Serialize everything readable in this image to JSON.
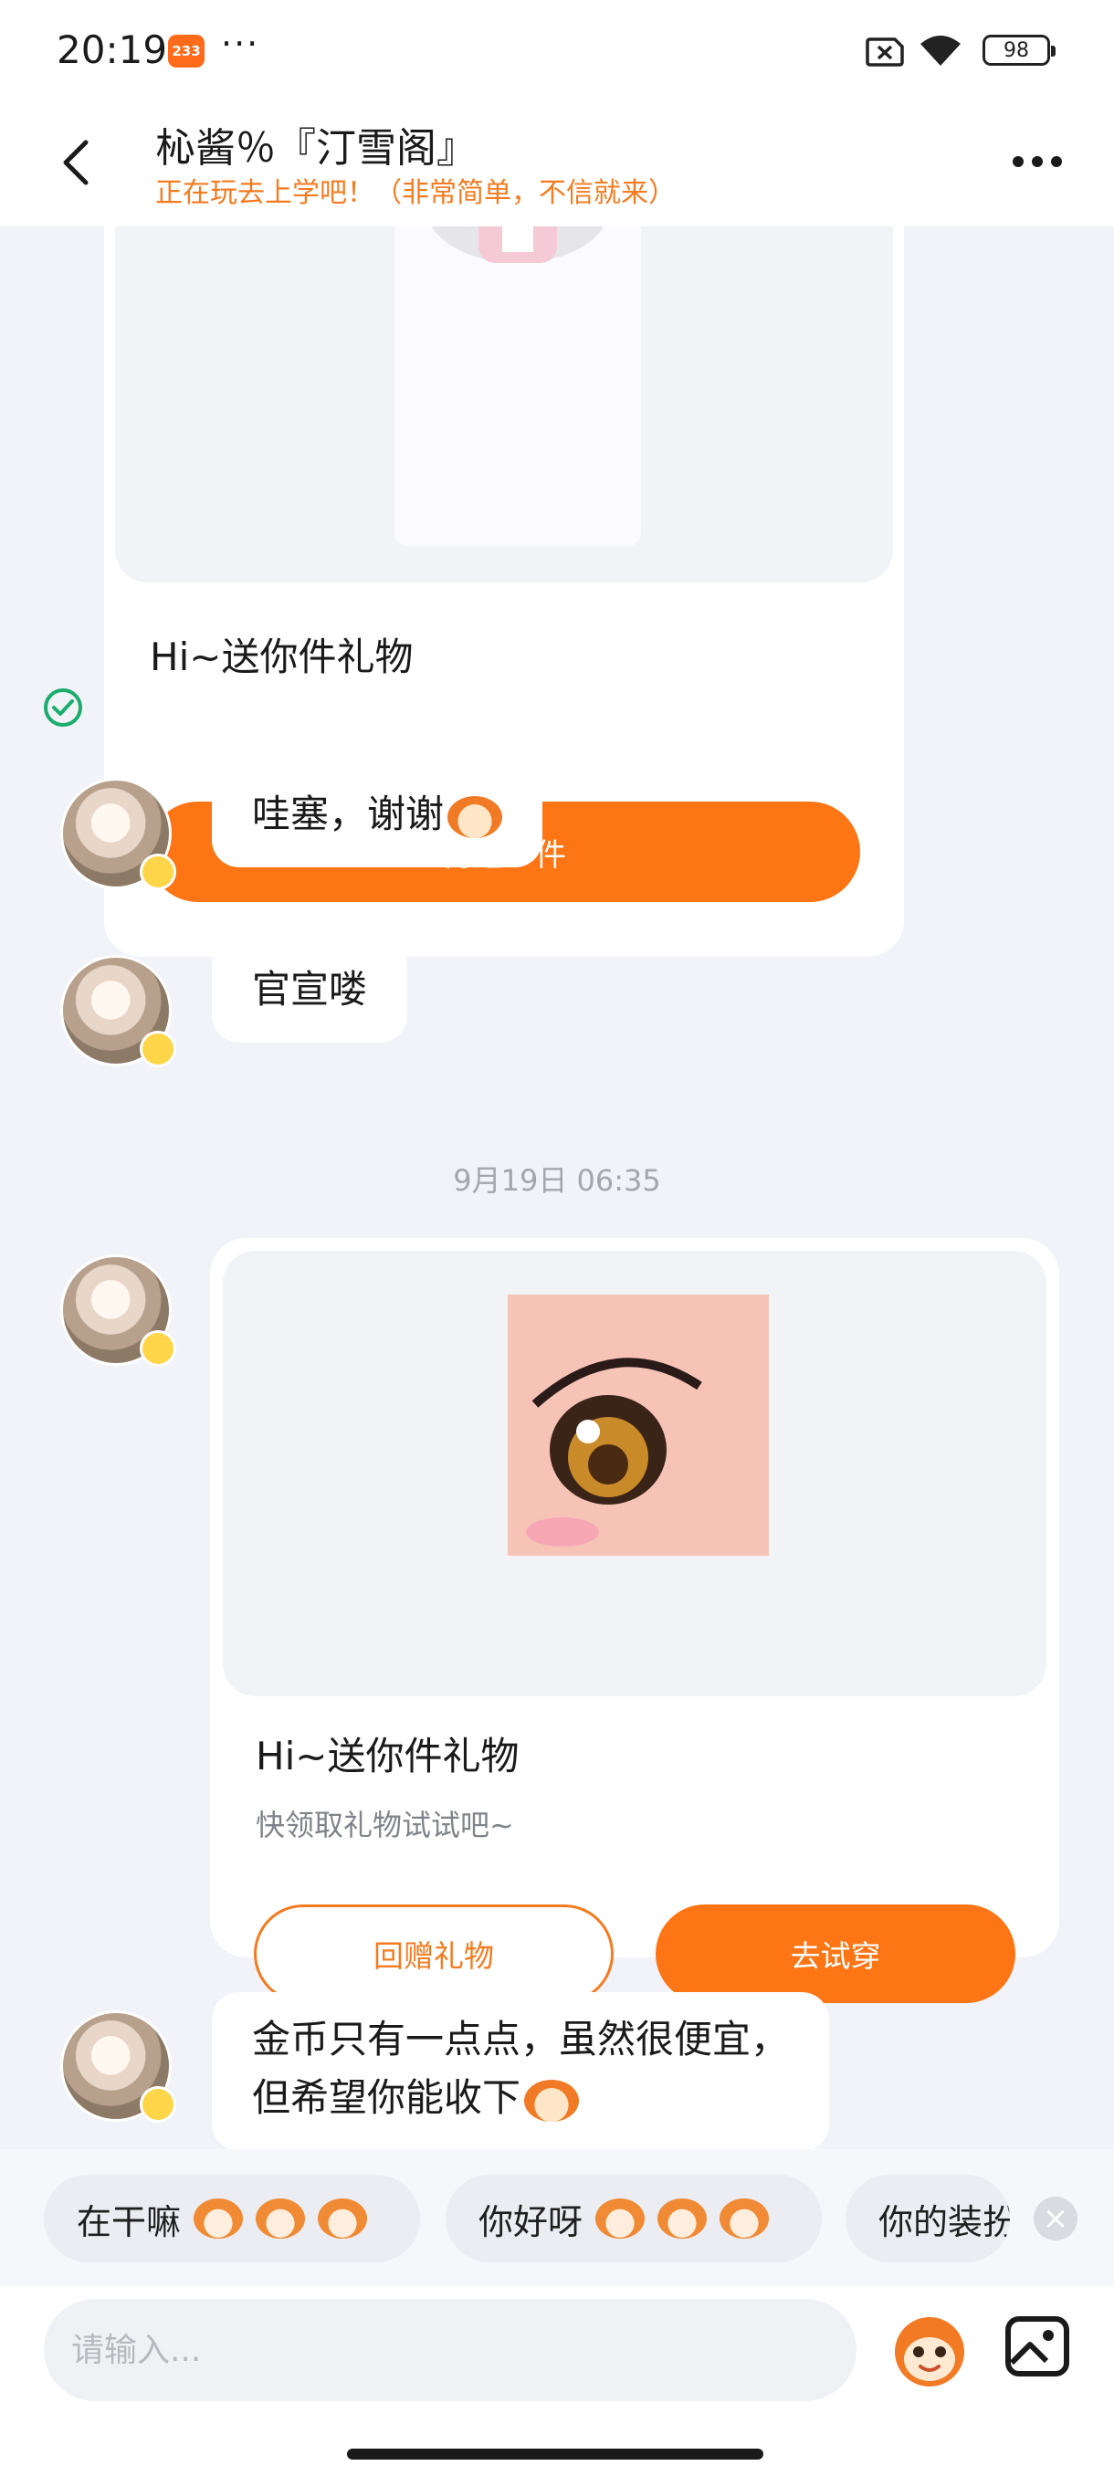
{
  "status_bar": {
    "time": "20:19",
    "app_badge": "233",
    "more": "···",
    "battery": "98"
  },
  "header": {
    "title": "杺酱％『汀雪阁』",
    "subtitle": "正在玩去上学吧！（非常简单，不信就来）"
  },
  "messages": {
    "gift_1": {
      "text": "Hi~送你件礼物",
      "resend_label": "再送一件"
    },
    "text_1": "哇塞，谢谢",
    "text_2": "官宣喽",
    "timestamp": "9月19日 06:35",
    "gift_2": {
      "text": "Hi~送你件礼物",
      "hint": "快领取礼物试试吧~",
      "return_label": "回赠礼物",
      "try_on_label": "去试穿"
    },
    "text_3_line_1": "金币只有一点点，虽然很便宜，",
    "text_3_line_2": "但希望你能收下"
  },
  "quick_replies": [
    {
      "label": "在干嘛"
    },
    {
      "label": "你好呀"
    },
    {
      "label": "你的装扮"
    }
  ],
  "input": {
    "placeholder": "请输入..."
  },
  "colors": {
    "accent": "#fd7514",
    "subtitle": "#f47b20",
    "read_check": "#1aad6e"
  }
}
